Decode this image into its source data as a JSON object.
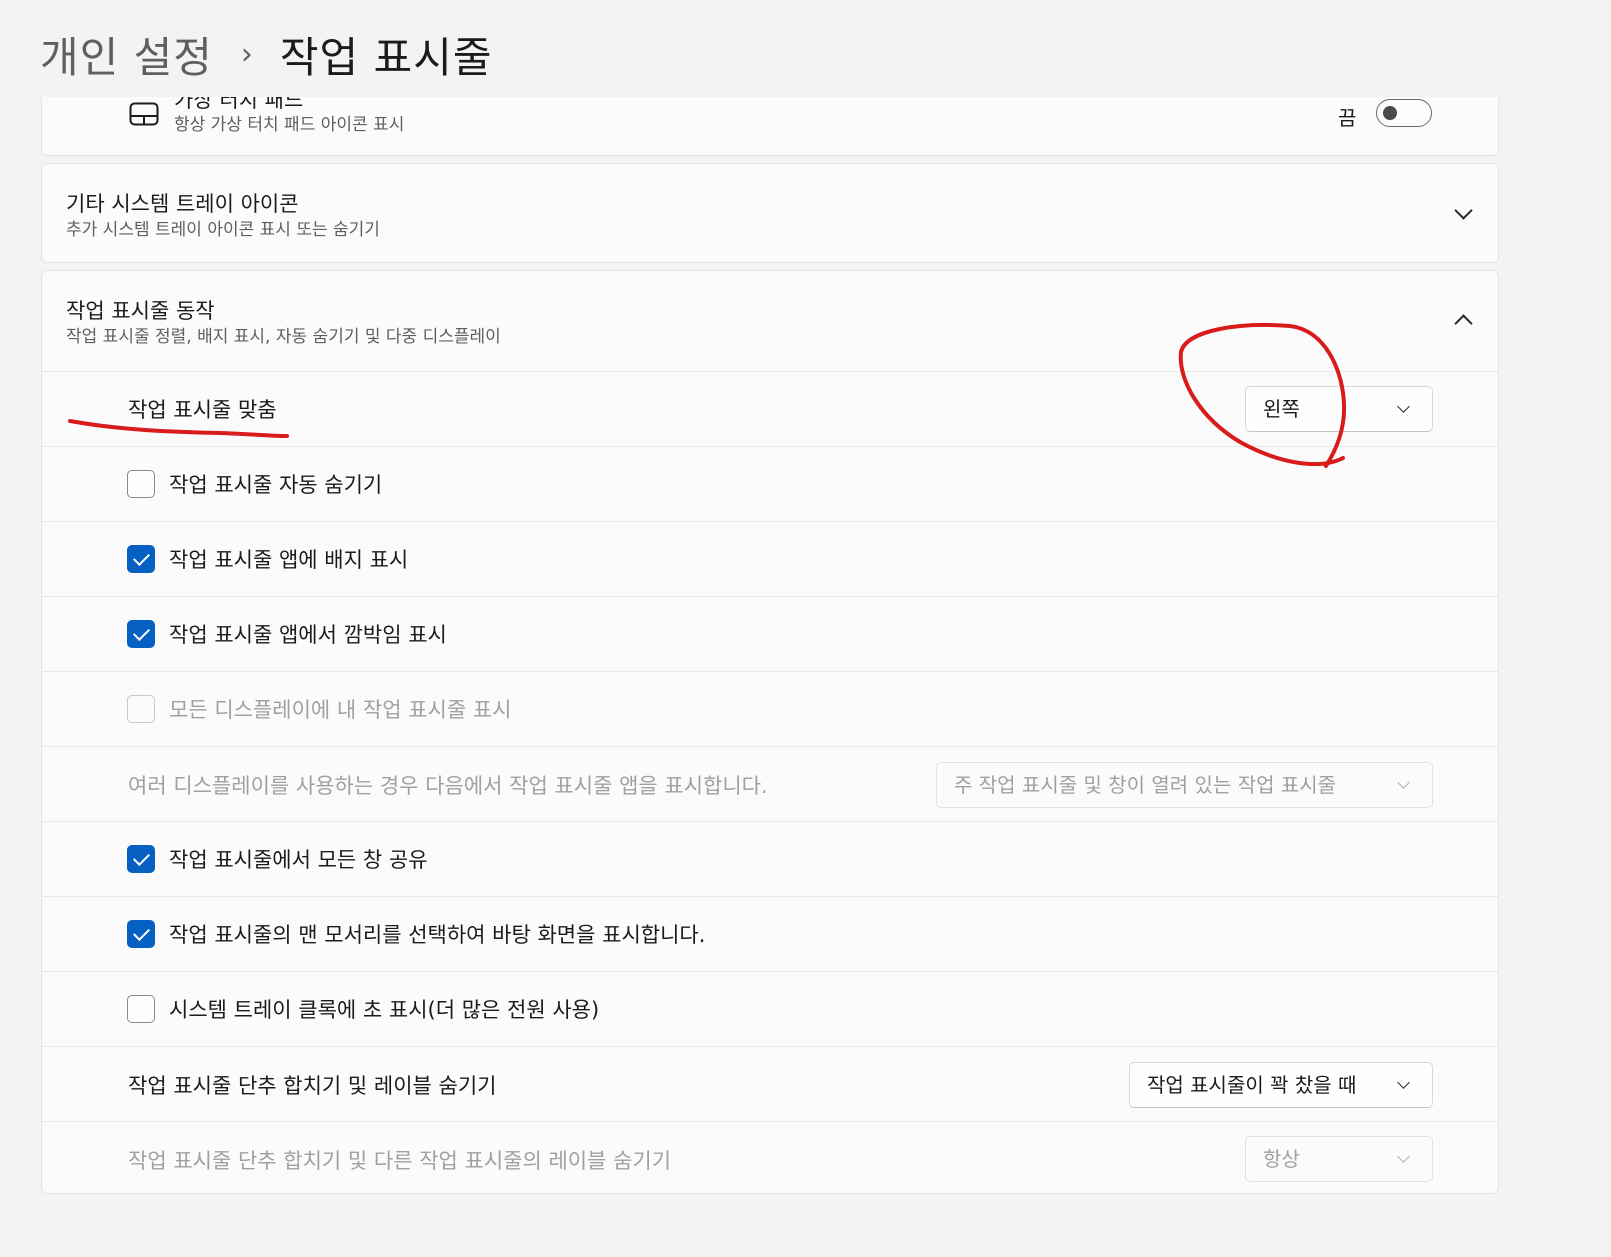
{
  "breadcrumb": {
    "parent": "개인 설정",
    "separator": "›",
    "current": "작업 표시줄"
  },
  "touchpad": {
    "title": "가상 터치 패드",
    "subtitle": "항상 가상 터치 패드 아이콘 표시",
    "toggle_label": "끔",
    "toggle_on": false,
    "icon": "touchpad-icon"
  },
  "other_tray": {
    "title": "기타 시스템 트레이 아이콘",
    "subtitle": "추가 시스템 트레이 아이콘 표시 또는 숨기기"
  },
  "behaviors": {
    "title": "작업 표시줄 동작",
    "subtitle": "작업 표시줄 정렬, 배지 표시, 자동 숨기기 및 다중 디스플레이",
    "alignment": {
      "label": "작업 표시줄 맞춤",
      "value": "왼쪽"
    },
    "auto_hide": {
      "label": "작업 표시줄 자동 숨기기",
      "checked": false
    },
    "badges": {
      "label": "작업 표시줄 앱에 배지 표시",
      "checked": true
    },
    "flashing": {
      "label": "작업 표시줄 앱에서 깜박임 표시",
      "checked": true
    },
    "all_displays": {
      "label": "모든 디스플레이에 내 작업 표시줄 표시",
      "checked": false,
      "disabled": true
    },
    "multi_display": {
      "label": "여러 디스플레이를 사용하는 경우 다음에서 작업 표시줄 앱을 표시합니다.",
      "value": "주 작업 표시줄 및 창이 열려 있는 작업 표시줄"
    },
    "share_window": {
      "label": "작업 표시줄에서 모든 창 공유",
      "checked": true
    },
    "far_corner": {
      "label": "작업 표시줄의 맨 모서리를 선택하여 바탕 화면을 표시합니다.",
      "checked": true
    },
    "clock_seconds": {
      "label": "시스템 트레이 클록에 초 표시(더 많은 전원 사용)",
      "checked": false
    },
    "combine": {
      "label": "작업 표시줄 단추 합치기 및 레이블 숨기기",
      "value": "작업 표시줄이 꽉 찼을 때"
    },
    "combine_other": {
      "label": "작업 표시줄 단추 합치기 및 다른 작업 표시줄의 레이블 숨기기",
      "value": "항상"
    }
  },
  "colors": {
    "accent": "#0560c2",
    "annotation": "#d81b1b",
    "background": "#f3f3f3",
    "card": "#fbfbfb"
  }
}
